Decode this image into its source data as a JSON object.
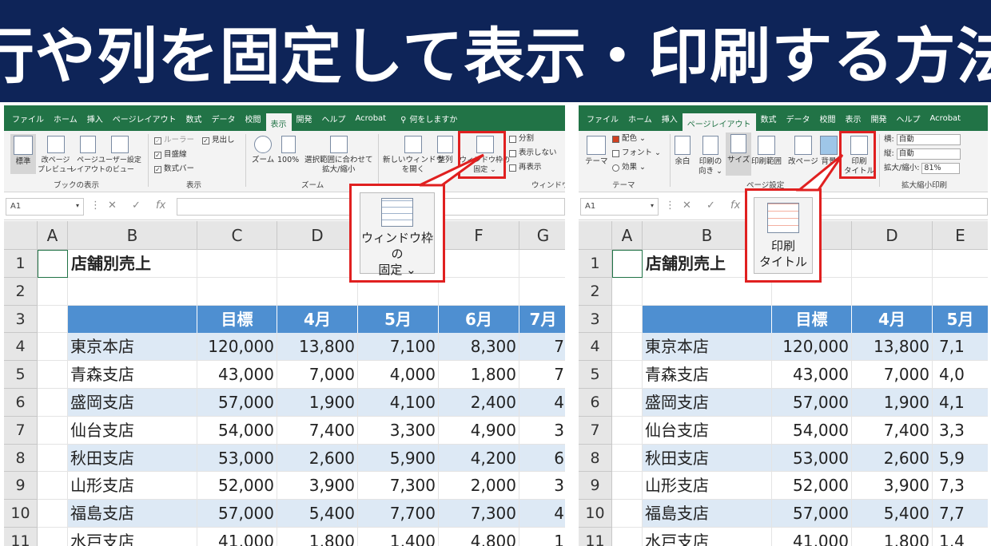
{
  "banner": {
    "title": "行や列を固定して表示・印刷する方法"
  },
  "colors": {
    "banner_bg": "#0e2458",
    "ribbon_tab_bar": "#217346",
    "table_header": "#4e8fd1",
    "stripe": "#dde9f5",
    "highlight": "#e02020"
  },
  "left": {
    "tabs": [
      "ファイル",
      "ホーム",
      "挿入",
      "ページレイアウト",
      "数式",
      "データ",
      "校閲",
      "表示",
      "開発",
      "ヘルプ",
      "Acrobat"
    ],
    "active_tab": "表示",
    "tell_me": "何をしますか",
    "ribbon": {
      "normal": "標準",
      "page_break": "改ページ\nプレビュー",
      "page_layout": "ページ\nレイアウト",
      "custom_view": "ユーザー設定\nのビュー",
      "group_book_view": "ブックの表示",
      "ruler": "ルーラー",
      "headings": "見出し",
      "gridlines": "目盛線",
      "formula_bar": "数式バー",
      "group_show": "表示",
      "zoom": "ズーム",
      "zoom100": "100%",
      "zoom_sel": "選択範囲に合わせて\n拡大/縮小",
      "group_zoom": "ズーム",
      "new_window": "新しいウィンドウ\nを開く",
      "arrange": "整列",
      "freeze": "ウィンドウ枠の\n固定 ⌄",
      "split": "分割",
      "hide": "表示しない",
      "unhide": "再表示",
      "group_window": "ウィンドウ"
    },
    "name_box": "A1",
    "callout": "ウィンドウ枠の\n固定 ⌄",
    "columns": [
      "A",
      "B",
      "C",
      "D",
      "E",
      "F",
      "G"
    ],
    "month_headers": [
      "目標",
      "4月",
      "5月",
      "6月",
      "7月"
    ]
  },
  "right": {
    "tabs": [
      "ファイル",
      "ホーム",
      "挿入",
      "ページレイアウト",
      "数式",
      "データ",
      "校閲",
      "表示",
      "開発",
      "ヘルプ",
      "Acrobat"
    ],
    "active_tab": "ページレイアウト",
    "ribbon": {
      "theme": "テーマ",
      "colors": "配色 ⌄",
      "fonts": "フォント ⌄",
      "effects": "効果 ⌄",
      "group_theme": "テーマ",
      "margins": "余白",
      "orientation": "印刷の\n向き ⌄",
      "size": "サイズ",
      "print_area": "印刷範囲",
      "breaks": "改ページ",
      "background": "背景",
      "print_titles": "印刷\nタイトル",
      "group_page_setup": "ページ設定",
      "width_label": "横:",
      "width_val": "自動",
      "height_label": "縦:",
      "height_val": "自動",
      "scale_label": "拡大/縮小:",
      "scale_val": "81%",
      "group_scale": "拡大縮小印刷"
    },
    "name_box": "A1",
    "callout": "印刷\nタイトル",
    "columns": [
      "A",
      "B",
      "",
      "D",
      "E"
    ],
    "month_headers": [
      "目標",
      "4月",
      "5月"
    ]
  },
  "sheet": {
    "title": "店舗別売上",
    "row_numbers": [
      "1",
      "2",
      "3",
      "4",
      "5",
      "6",
      "7",
      "8",
      "9",
      "10",
      "11"
    ],
    "rows": [
      {
        "store": "東京本店",
        "target": "120,000",
        "apr": "13,800",
        "may": "7,100",
        "jun": "8,300",
        "jul": "7"
      },
      {
        "store": "青森支店",
        "target": "43,000",
        "apr": "7,000",
        "may": "4,000",
        "jun": "1,800",
        "jul": "7"
      },
      {
        "store": "盛岡支店",
        "target": "57,000",
        "apr": "1,900",
        "may": "4,100",
        "jun": "2,400",
        "jul": "4"
      },
      {
        "store": "仙台支店",
        "target": "54,000",
        "apr": "7,400",
        "may": "3,300",
        "jun": "4,900",
        "jul": "3"
      },
      {
        "store": "秋田支店",
        "target": "53,000",
        "apr": "2,600",
        "may": "5,900",
        "jun": "4,200",
        "jul": "6"
      },
      {
        "store": "山形支店",
        "target": "52,000",
        "apr": "3,900",
        "may": "7,300",
        "jun": "2,000",
        "jul": "3"
      },
      {
        "store": "福島支店",
        "target": "57,000",
        "apr": "5,400",
        "may": "7,700",
        "jun": "7,300",
        "jul": "4"
      },
      {
        "store": "水戸支店",
        "target": "41,000",
        "apr": "1,800",
        "may": "1,400",
        "jun": "4,800",
        "jul": "1"
      }
    ],
    "right_may_partial": [
      "7,1",
      "4,0",
      "4,1",
      "3,3",
      "5,9",
      "7,3",
      "7,7",
      "1,4"
    ],
    "right_may_header": "5月"
  }
}
